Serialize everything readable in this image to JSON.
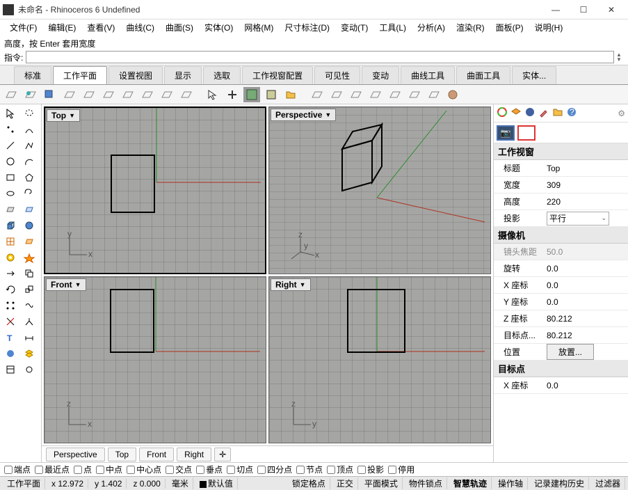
{
  "window": {
    "title": "未命名 - Rhinoceros 6 Undefined"
  },
  "menu": [
    "文件(F)",
    "编辑(E)",
    "查看(V)",
    "曲线(C)",
    "曲面(S)",
    "实体(O)",
    "网格(M)",
    "尺寸标注(D)",
    "变动(T)",
    "工具(L)",
    "分析(A)",
    "渲染(R)",
    "面板(P)",
    "说明(H)"
  ],
  "cmd": {
    "hint": "高度，按 Enter 套用宽度",
    "prompt": "指令:"
  },
  "tabs": [
    "标准",
    "工作平面",
    "设置视图",
    "显示",
    "选取",
    "工作视窗配置",
    "可见性",
    "变动",
    "曲线工具",
    "曲面工具",
    "实体..."
  ],
  "activeTab": 1,
  "viewports": {
    "tl": "Top",
    "tr": "Perspective",
    "bl": "Front",
    "br": "Right"
  },
  "vptabs": [
    "Perspective",
    "Top",
    "Front",
    "Right"
  ],
  "properties": {
    "section1": "工作视窗",
    "rows1": [
      {
        "label": "标题",
        "value": "Top"
      },
      {
        "label": "宽度",
        "value": "309"
      },
      {
        "label": "高度",
        "value": "220"
      },
      {
        "label": "投影",
        "value": "平行"
      }
    ],
    "section2": "摄像机",
    "rows2": [
      {
        "label": "镜头焦距",
        "value": "50.0"
      },
      {
        "label": "旋转",
        "value": "0.0"
      },
      {
        "label": "X 座标",
        "value": "0.0"
      },
      {
        "label": "Y 座标",
        "value": "0.0"
      },
      {
        "label": "Z 座标",
        "value": "80.212"
      },
      {
        "label": "目标点...",
        "value": "80.212"
      }
    ],
    "placeLabel": "位置",
    "placeBtn": "放置...",
    "section3": "目标点",
    "rows3": [
      {
        "label": "X 座标",
        "value": "0.0"
      }
    ]
  },
  "osnap": [
    "端点",
    "最近点",
    "点",
    "中点",
    "中心点",
    "交点",
    "垂点",
    "切点",
    "四分点",
    "节点",
    "顶点",
    "投影",
    "停用"
  ],
  "status": {
    "plane": "工作平面",
    "x": "x 12.972",
    "y": "y 1.402",
    "z": "z 0.000",
    "unit": "毫米",
    "layer": "默认值",
    "items": [
      "锁定格点",
      "正交",
      "平面模式",
      "物件锁点",
      "智慧轨迹",
      "操作轴",
      "记录建构历史",
      "过滤器"
    ]
  }
}
